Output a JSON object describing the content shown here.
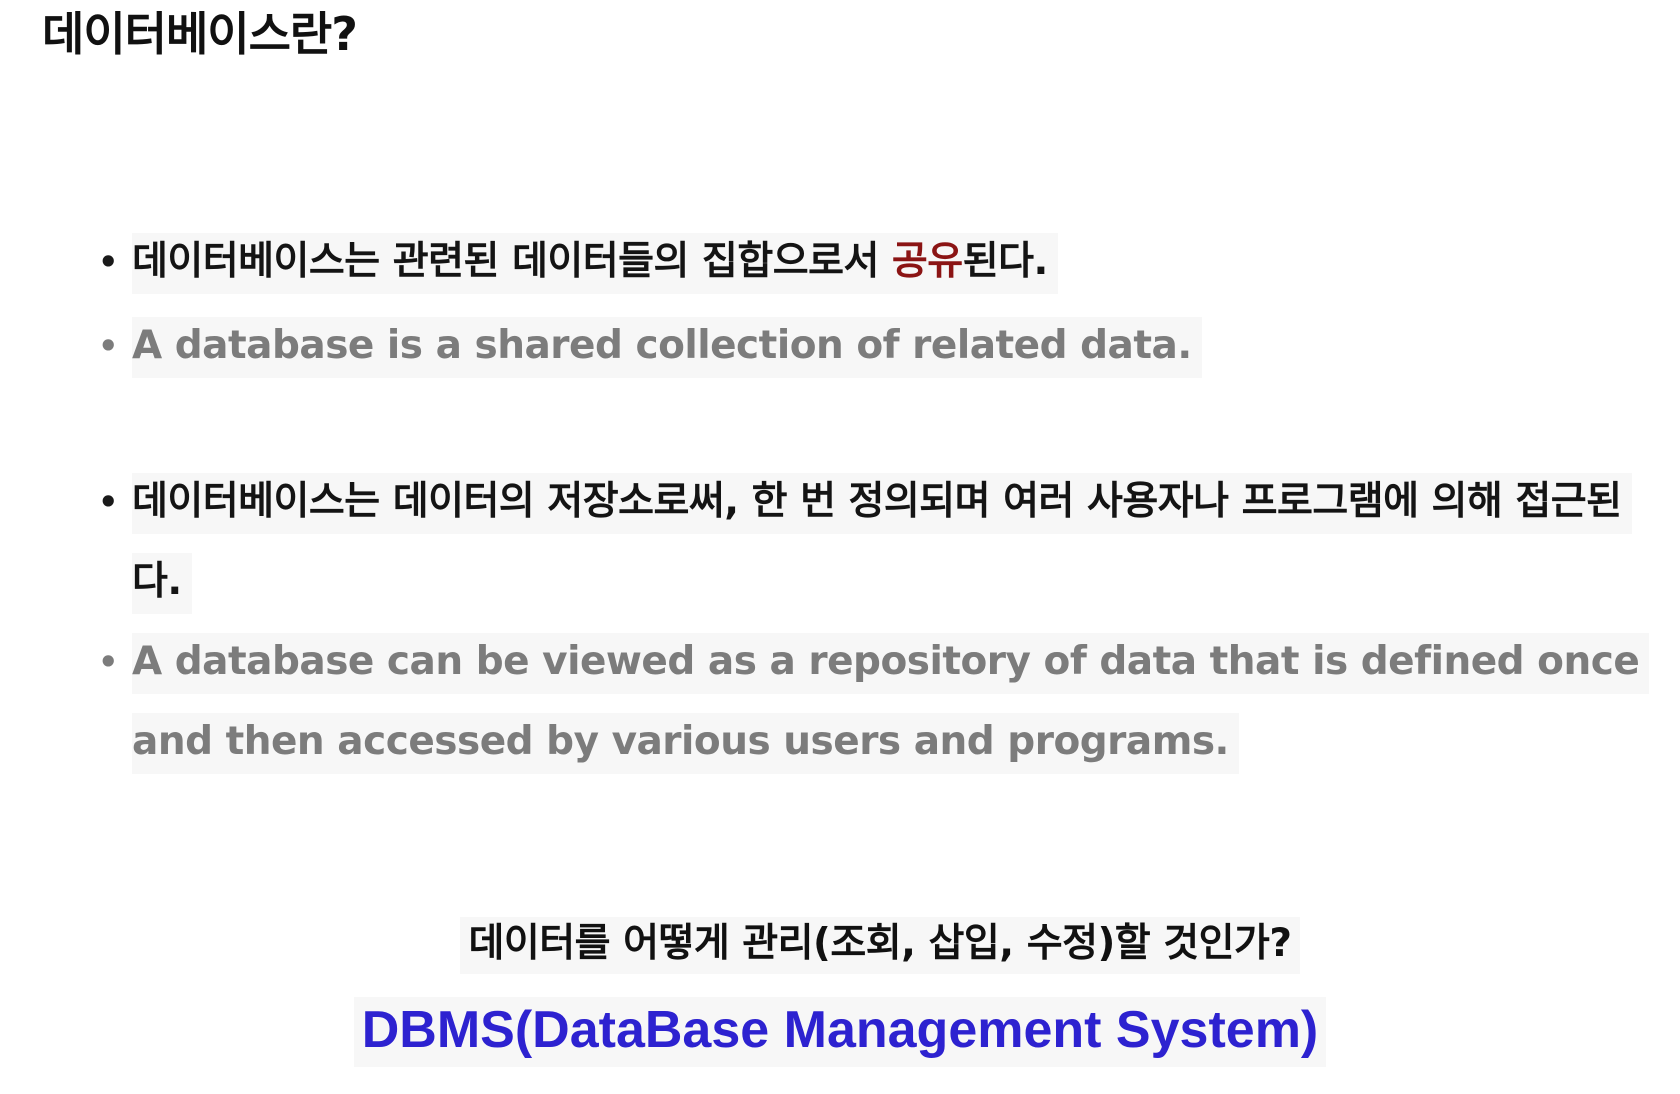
{
  "title": "데이터베이스란?",
  "sections": [
    {
      "ko": {
        "before": "데이터베이스는 관련된 데이터들의 집합으로서 ",
        "emphasis": "공유",
        "after": "된다."
      },
      "en": "A database is a shared collection of related data."
    },
    {
      "ko": "데이터베이스는 데이터의 저장소로써, 한 번 정의되며 여러 사용자나 프로그램에 의해 접근된다.",
      "en": "A database can be viewed as a repository of data that is defined once and then accessed by various users and programs."
    }
  ],
  "bullet": "•",
  "question": "데이터를 어떻게 관리(조회, 삽입, 수정)할 것인가?",
  "answer": "DBMS(DataBase Management System)",
  "colors": {
    "emphasis": "#8b1414",
    "english_text": "#7c7c7c",
    "answer": "#2d22d0",
    "highlight": "#f7f7f7"
  }
}
